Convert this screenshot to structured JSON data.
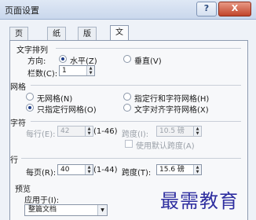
{
  "window": {
    "title": "页面设置",
    "help_label": "?",
    "close_label": "X"
  },
  "tabs": [
    {
      "label": "页边距",
      "active": false
    },
    {
      "label": "纸张",
      "active": false
    },
    {
      "label": "版式",
      "active": false
    },
    {
      "label": "文档网格",
      "active": true
    }
  ],
  "text_direction": {
    "section_label": "文字排列",
    "direction_label": "方向:",
    "horizontal_label": "水平(Z)",
    "vertical_label": "垂直(V)",
    "selected": "horizontal",
    "columns_label": "栏数(C):",
    "columns_value": "1"
  },
  "grid": {
    "section_label": "网格",
    "options": [
      {
        "label": "无网格(N)",
        "selected": false
      },
      {
        "label": "指定行和字符网格(H)",
        "selected": false
      },
      {
        "label": "只指定行网格(O)",
        "selected": true
      },
      {
        "label": "文字对齐字符网格(X)",
        "selected": false
      }
    ]
  },
  "chars": {
    "section_label": "字符",
    "per_line_label": "每行(E):",
    "per_line_value": "42",
    "range": "(1-46)",
    "pitch_label": "跨度(I):",
    "pitch_value": "10.5 磅",
    "default_pitch_label": "使用默认跨度(A)"
  },
  "lines": {
    "section_label": "行",
    "per_page_label": "每页(R):",
    "per_page_value": "40",
    "range": "(1-44)",
    "pitch_label": "跨度(T):",
    "pitch_value": "15.6 磅"
  },
  "preview": {
    "section_label": "预览",
    "apply_to_label": "应用于(I):",
    "apply_to_value": "整篇文档"
  },
  "watermark": "最需教育",
  "icons": {
    "spin_up": "▲",
    "spin_down": "▼",
    "drop": "▼"
  }
}
